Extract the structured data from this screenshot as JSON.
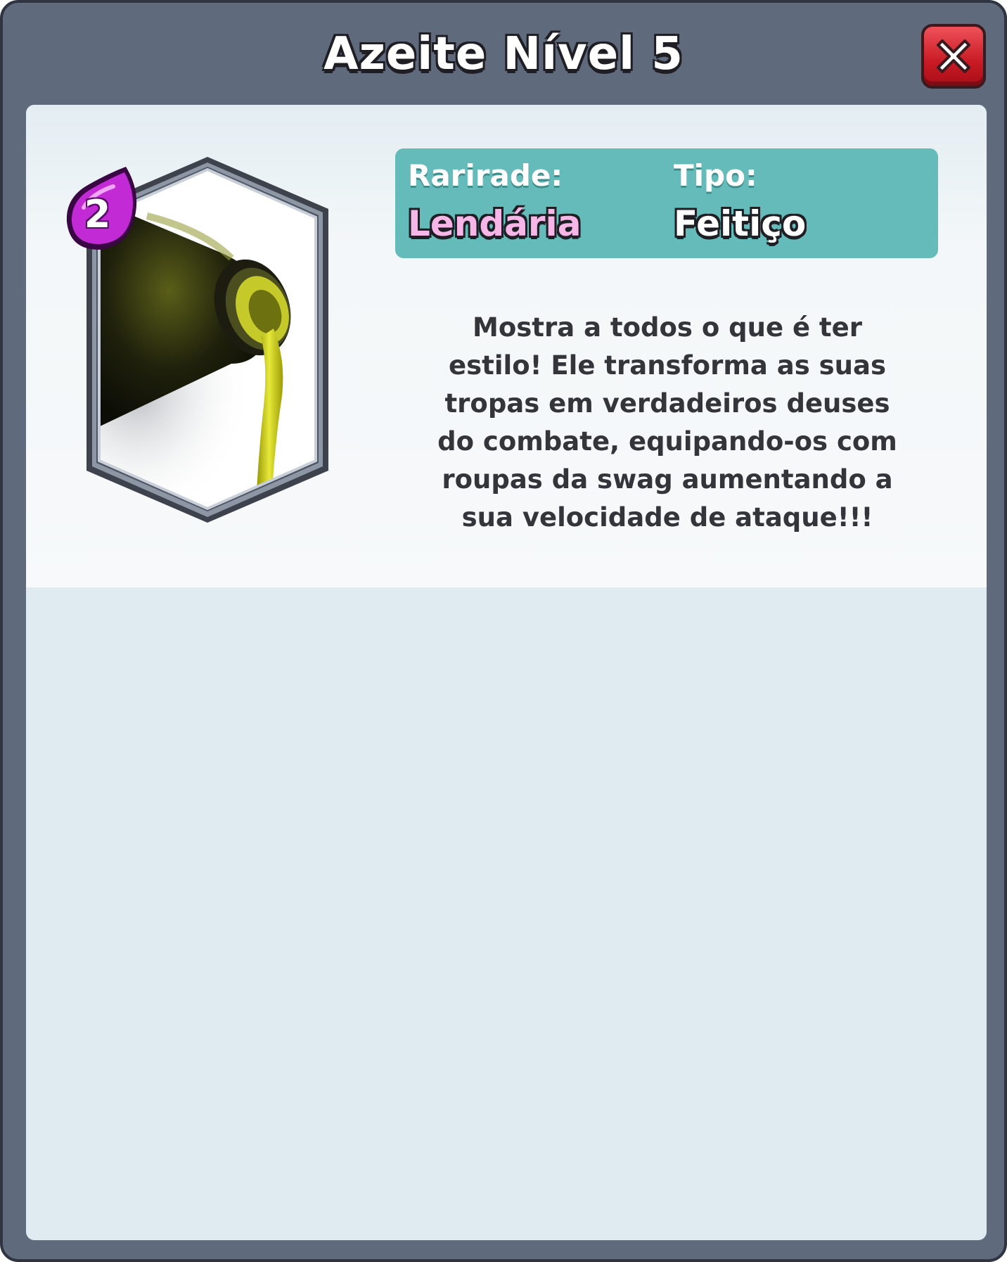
{
  "dialog": {
    "title": "Azeite Nível 5",
    "close_icon": "close-x-icon"
  },
  "card": {
    "elixir_cost": "2",
    "elixir_icon": "elixir-drop-icon",
    "image": "olive-oil-bottle-pouring",
    "frame_icon": "hexagon-card-frame"
  },
  "info": {
    "rarity_label": "Rarirade:",
    "rarity_value": "Lendária",
    "type_label": "Tipo:",
    "type_value": "Feitiço"
  },
  "description": {
    "lines": [
      "Mostra a todos o que é ter",
      "estilo! Ele transforma as suas",
      "tropas em verdadeiros deuses",
      "do combate, equipando-os com",
      "roupas da swag aumentando a",
      "sua velocidade de ataque!!!"
    ]
  },
  "colors": {
    "frame": "#5f6a7d",
    "info_box": "#64bbb9",
    "close_button": "#d8242e",
    "legendary_text": "#f6b6e8",
    "elixir": "#c22ad6"
  }
}
